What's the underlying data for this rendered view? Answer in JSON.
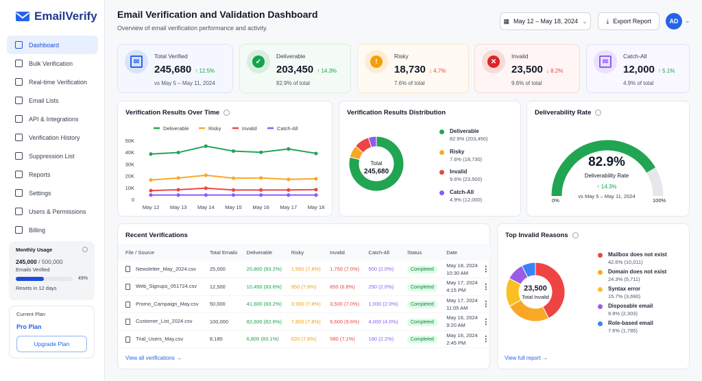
{
  "app": {
    "name": "EmailVerify"
  },
  "sidebar": {
    "items": [
      {
        "label": "Dashboard",
        "active": true
      },
      {
        "label": "Bulk Verification"
      },
      {
        "label": "Real-time Verification"
      },
      {
        "label": "Email Lists"
      },
      {
        "label": "API & Integrations"
      },
      {
        "label": "Verification History"
      },
      {
        "label": "Suppression List"
      },
      {
        "label": "Reports"
      },
      {
        "label": "Settings"
      },
      {
        "label": "Users & Permissions"
      },
      {
        "label": "Billing"
      }
    ],
    "usage": {
      "title": "Monthly Usage",
      "used": "245,000",
      "total": "/ 500,000",
      "label": "Emails Verified",
      "percent": 49,
      "percent_label": "49%",
      "reset": "Resets in 12 days"
    },
    "plan": {
      "title": "Current Plan",
      "name": "Pro Plan",
      "upgrade": "Upgrade Plan"
    }
  },
  "header": {
    "title": "Email Verification and Validation Dashboard",
    "subtitle": "Overview of email verification performance and activity.",
    "date_range": "May 12 – May 18, 2024",
    "export": "Export Report",
    "avatar": "AD"
  },
  "kpis": [
    {
      "label": "Total Verified",
      "value": "245,680",
      "change": "↑ 12.5%",
      "sub": "vs May 5 – May 11, 2024",
      "color": "#2563eb",
      "bg": "#f5f7ff",
      "border": "#dbe4fb",
      "icon": "mail-icon"
    },
    {
      "label": "Deliverable",
      "value": "203,450",
      "change": "↑ 14.3%",
      "sub": "82.9% of total",
      "color": "#16a34a",
      "bg": "#f4fbf6",
      "border": "#d9efdf",
      "icon": "check-circle-icon"
    },
    {
      "label": "Risky",
      "value": "18,730",
      "change": "↓ 4.7%",
      "sub": "7.6% of total",
      "color": "#f59e0b",
      "bg": "#fffaf2",
      "border": "#fbe8c8",
      "icon": "warning-icon"
    },
    {
      "label": "Invalid",
      "value": "23,500",
      "change": "↓ 8.2%",
      "sub": "9.6% of total",
      "color": "#dc2626",
      "bg": "#fff5f5",
      "border": "#f8d9d9",
      "icon": "x-circle-icon"
    },
    {
      "label": "Catch-All",
      "value": "12,000",
      "change": "↑ 5.1%",
      "sub": "4.9% of total",
      "color": "#8b5cf6",
      "bg": "#f9f7ff",
      "border": "#e6e0fb",
      "icon": "mail-icon"
    }
  ],
  "chart_data": [
    {
      "type": "line",
      "title": "Verification Results Over Time",
      "categories": [
        "May 12",
        "May 13",
        "May 14",
        "May 15",
        "May 16",
        "May 17",
        "May 18"
      ],
      "ylim": [
        0,
        50000
      ],
      "yticks": [
        "0",
        "10K",
        "20K",
        "30K",
        "40K",
        "50K"
      ],
      "legend": "top",
      "series": [
        {
          "name": "Deliverable",
          "color": "#22a552",
          "values": [
            38500,
            39800,
            45200,
            41000,
            40000,
            42800,
            39000
          ]
        },
        {
          "name": "Risky",
          "color": "#f9a825",
          "values": [
            16500,
            18200,
            20500,
            18000,
            18200,
            17000,
            17500
          ]
        },
        {
          "name": "Invalid",
          "color": "#ef4444",
          "values": [
            7500,
            8200,
            9500,
            8000,
            8000,
            8000,
            8300
          ]
        },
        {
          "name": "Catch-All",
          "color": "#8b5cf6",
          "values": [
            3700,
            3700,
            3700,
            3700,
            3700,
            3700,
            3700
          ]
        }
      ]
    },
    {
      "type": "pie",
      "title": "Verification Results Distribution",
      "center_label": "Total",
      "center_value": "245,680",
      "slices": [
        {
          "name": "Deliverable",
          "value": 82.9,
          "detail": "82.9% (203,450)",
          "color": "#22a552"
        },
        {
          "name": "Risky",
          "value": 7.6,
          "detail": "7.6% (18,730)",
          "color": "#f9a825"
        },
        {
          "name": "Invalid",
          "value": 9.6,
          "detail": "9.6% (23,500)",
          "color": "#ef4444"
        },
        {
          "name": "Catch-All",
          "value": 4.9,
          "detail": "4.9% (12,000)",
          "color": "#8b5cf6"
        }
      ]
    },
    {
      "type": "gauge",
      "title": "Deliverability Rate",
      "value": 82.9,
      "value_label": "82.9%",
      "label": "Deliverability Rate",
      "change": "↑ 14.3%",
      "sub": "vs May 5 – May 11, 2024",
      "min_label": "0%",
      "max_label": "100%",
      "color": "#22a552"
    },
    {
      "type": "pie",
      "title": "Top Invalid Reasons",
      "center_value": "23,500",
      "center_label": "Total Invalid",
      "slices": [
        {
          "name": "Mailbox does not exist",
          "value": 42.6,
          "detail": "42.6% (10,011)",
          "color": "#ef4444"
        },
        {
          "name": "Domain does not exist",
          "value": 24.3,
          "detail": "24.3% (5,711)",
          "color": "#f9a825"
        },
        {
          "name": "Syntax error",
          "value": 15.7,
          "detail": "15.7% (3,690)",
          "color": "#fbbf24"
        },
        {
          "name": "Disposable email",
          "value": 9.8,
          "detail": "9.8% (2,303)",
          "color": "#9b5de5"
        },
        {
          "name": "Role-based email",
          "value": 7.6,
          "detail": "7.6% (1,785)",
          "color": "#3b82f6"
        }
      ],
      "link": "View full report"
    }
  ],
  "recent": {
    "title": "Recent Verifications",
    "columns": [
      "File / Source",
      "Total Emails",
      "Deliverable",
      "Risky",
      "Invalid",
      "Catch-All",
      "Status",
      "Date"
    ],
    "rows": [
      [
        "Newsletter_May_2024.csv",
        "25,000",
        "20,800 (83.2%)",
        "1,950 (7.8%)",
        "1,750 (7.0%)",
        "500 (2.0%)",
        "Completed",
        "May 18, 2024",
        "10:30 AM"
      ],
      [
        "Web_Signups_051724.csv",
        "12,500",
        "10,450 (83.6%)",
        "950 (7.6%)",
        "850 (6.8%)",
        "250 (2.0%)",
        "Completed",
        "May 17, 2024",
        "4:15 PM"
      ],
      [
        "Promo_Campaign_May.csv",
        "50,000",
        "41,600 (83.2%)",
        "3,900 (7.8%)",
        "3,500 (7.0%)",
        "1,000 (2.0%)",
        "Completed",
        "May 17, 2024",
        "11:05 AM"
      ],
      [
        "Customer_List_2024.csv",
        "100,000",
        "82,600 (82.6%)",
        "7,800 (7.8%)",
        "9,600 (9.6%)",
        "4,000 (4.0%)",
        "Completed",
        "May 16, 2024",
        "9:20 AM"
      ],
      [
        "Trial_Users_May.csv",
        "8,180",
        "6,800 (83.1%)",
        "620 (7.6%)",
        "580 (7.1%)",
        "180 (2.2%)",
        "Completed",
        "May 16, 2024",
        "2:45 PM"
      ]
    ],
    "link": "View all verifications"
  }
}
